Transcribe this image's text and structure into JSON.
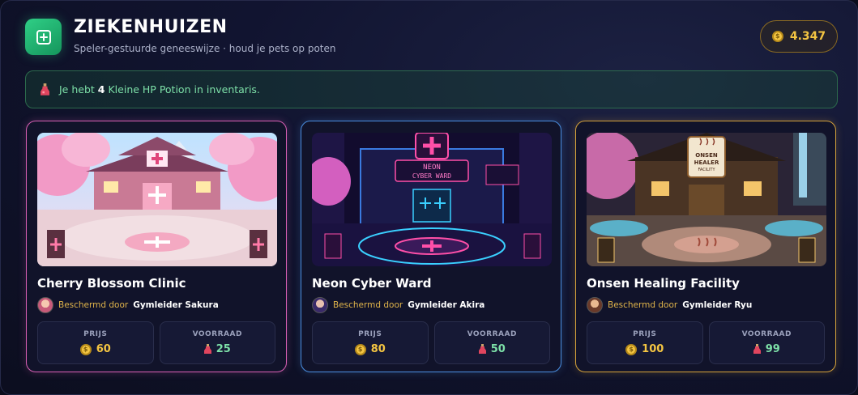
{
  "header": {
    "title": "ZIEKENHUIZEN",
    "subtitle": "Speler-gestuurde geneeswijze · houd je pets op poten",
    "icon": "plus-box-icon"
  },
  "wallet": {
    "coins": "4.347",
    "icon": "coin-icon"
  },
  "banner": {
    "prefix": "Je hebt",
    "count": "4",
    "suffix": "Kleine HP Potion in inventaris.",
    "icon": "potion-icon"
  },
  "labels": {
    "price": "PRIJS",
    "stock": "VOORRAAD",
    "guarded_by": "Beschermd door"
  },
  "hospitals": [
    {
      "name": "Cherry Blossom Clinic",
      "leader": "Gymleider Sakura",
      "price": "60",
      "stock": "25",
      "accent": "#d85fb4"
    },
    {
      "name": "Neon Cyber Ward",
      "leader": "Gymleider Akira",
      "price": "80",
      "stock": "50",
      "accent": "#4a8ee0"
    },
    {
      "name": "Onsen Healing Facility",
      "leader": "Gymleider Ryu",
      "price": "100",
      "stock": "99",
      "accent": "#d4a13a"
    }
  ],
  "scenes": {
    "neon_sign_line1": "NEON",
    "neon_sign_line2": "CYBER WARD",
    "onsen_sign_line1": "ONSEN",
    "onsen_sign_line2": "HEALER",
    "onsen_sign_line3": "FACILITY"
  }
}
